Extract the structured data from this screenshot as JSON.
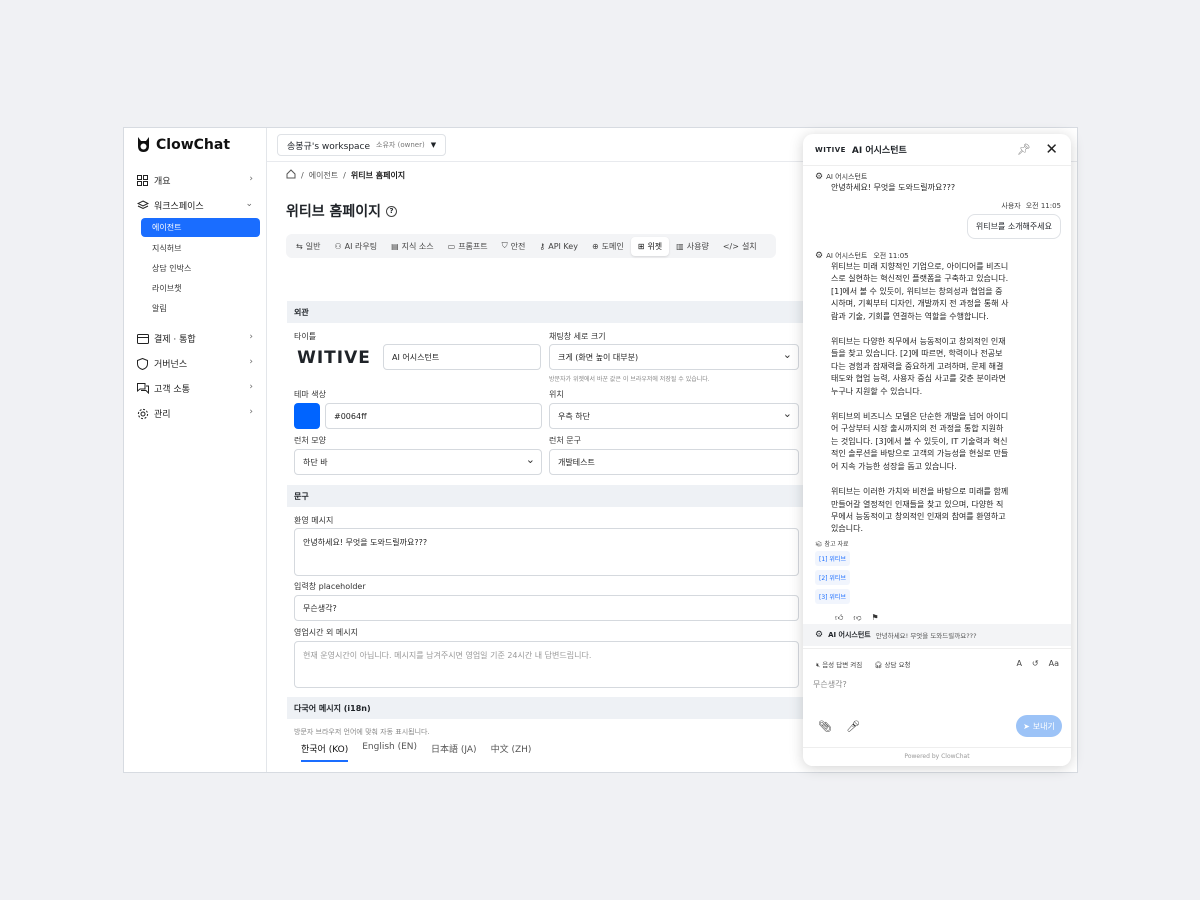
{
  "app": {
    "name": "ClowChat"
  },
  "sidebar": {
    "items": [
      {
        "label": "개요",
        "icon": "grid-icon"
      },
      {
        "label": "워크스페이스",
        "icon": "layers-icon"
      },
      {
        "label": "결제 · 통합",
        "icon": "card-icon"
      },
      {
        "label": "거버넌스",
        "icon": "shield-icon"
      },
      {
        "label": "고객 소통",
        "icon": "chat-icon"
      },
      {
        "label": "관리",
        "icon": "gear-icon"
      }
    ],
    "subitems": [
      "에이전트",
      "지식허브",
      "상담 인박스",
      "라이브챗",
      "알림"
    ]
  },
  "workspace": {
    "name": "송봉규's workspace",
    "role": "소유자 (owner)"
  },
  "breadcrumb": {
    "parent": "에이전트",
    "current": "위티브 홈페이지"
  },
  "page": {
    "title": "위티브 홈페이지"
  },
  "tabs": [
    "일반",
    "AI 라우팅",
    "지식 소스",
    "프롬프트",
    "안전",
    "API Key",
    "도메인",
    "위젯",
    "사용량",
    "설치"
  ],
  "appearance": {
    "section": "외관",
    "title_label": "타이틀",
    "logo_text": "WITIVE",
    "title_value": "AI 어시스턴트",
    "size_label": "채팅창 세로 크기",
    "size_value": "크게 (화면 높이 대부분)",
    "size_hint": "방문자가 위젯에서 바꾼 값은 이 브라우저에 저장될 수 있습니다.",
    "theme_label": "테마 색상",
    "theme_value": "#0064ff",
    "theme_color": "#0064ff",
    "position_label": "위치",
    "position_value": "우측 하단",
    "launcher_shape_label": "런처 모양",
    "launcher_shape_value": "하단 바",
    "launcher_text_label": "런처 문구",
    "launcher_text_value": "개발테스트"
  },
  "copy": {
    "section": "문구",
    "welcome_label": "환영 메시지",
    "welcome_value": "안녕하세요! 무엇을 도와드릴까요???",
    "placeholder_label": "입력창 placeholder",
    "placeholder_value": "무슨생각?",
    "offhours_label": "영업시간 외 메시지",
    "offhours_placeholder": "현재 운영시간이 아닙니다. 메시지를 남겨주시면 영업일 기준 24시간 내 답변드립니다."
  },
  "i18n": {
    "section": "다국어 메시지 (i18n)",
    "hint": "방문자 브라우저 언어에 맞춰 자동 표시됩니다.",
    "tabs": [
      "한국어 (KO)",
      "English (EN)",
      "日本語 (JA)",
      "中文 (ZH)"
    ]
  },
  "chat": {
    "brand": "WITIVE",
    "title": "AI 어시스턴트",
    "bot_name": "AI 어시스턴트",
    "greeting": "안녕하세요! 무엇을 도와드릴까요???",
    "user_name": "사용자",
    "user_time": "오전 11:05",
    "user_message": "위티브를 소개해주세요",
    "bot_time": "오전 11:05",
    "answer_p1": "위티브는 미래 지향적인 기업으로, 아이디어를 비즈니스로 실현하는 혁신적인 플랫폼을 구축하고 있습니다. [1]에서 볼 수 있듯이, 위티브는 창의성과 협업을 중시하며, 기획부터 디자인, 개발까지 전 과정을 통해 사람과 기술, 기회를 연결하는 역할을 수행합니다.",
    "answer_p2": "위티브는 다양한 직무에서 능동적이고 창의적인 인재들을 찾고 있습니다. [2]에 따르면, 학력이나 전공보다는 경험과 잠재력을 중요하게 고려하며, 문제 해결 태도와 협업 능력, 사용자 중심 사고를 갖춘 분이라면 누구나 지원할 수 있습니다.",
    "answer_p3": "위티브의 비즈니스 모델은 단순한 개발을 넘어 아이디어 구상부터 시장 출시까지의 전 과정을 통합 지원하는 것입니다. [3]에서 볼 수 있듯이, IT 기술력과 혁신적인 솔루션을 바탕으로 고객의 가능성을 현실로 만들어 지속 가능한 성장을 돕고 있습니다.",
    "answer_p4": "위티브는 이러한 가치와 비전을 바탕으로 미래를 함께 만들어갈 열정적인 인재들을 찾고 있으며, 다양한 직무에서 능동적이고 창의적인 인재의 참여를 환영하고 있습니다.",
    "refs_label": "참고 자료",
    "refs": [
      "[1] 위티브",
      "[2] 위티브",
      "[3] 위티브"
    ],
    "notice_name": "AI 어시스턴트",
    "notice_text": "안녕하세요! 무엇을 도와드릴까요???",
    "voice_label": "음성 답변 켜짐",
    "agent_label": "상담 요청",
    "input_placeholder": "무슨생각?",
    "send_label": "보내기",
    "powered": "Powered by ClowChat"
  }
}
